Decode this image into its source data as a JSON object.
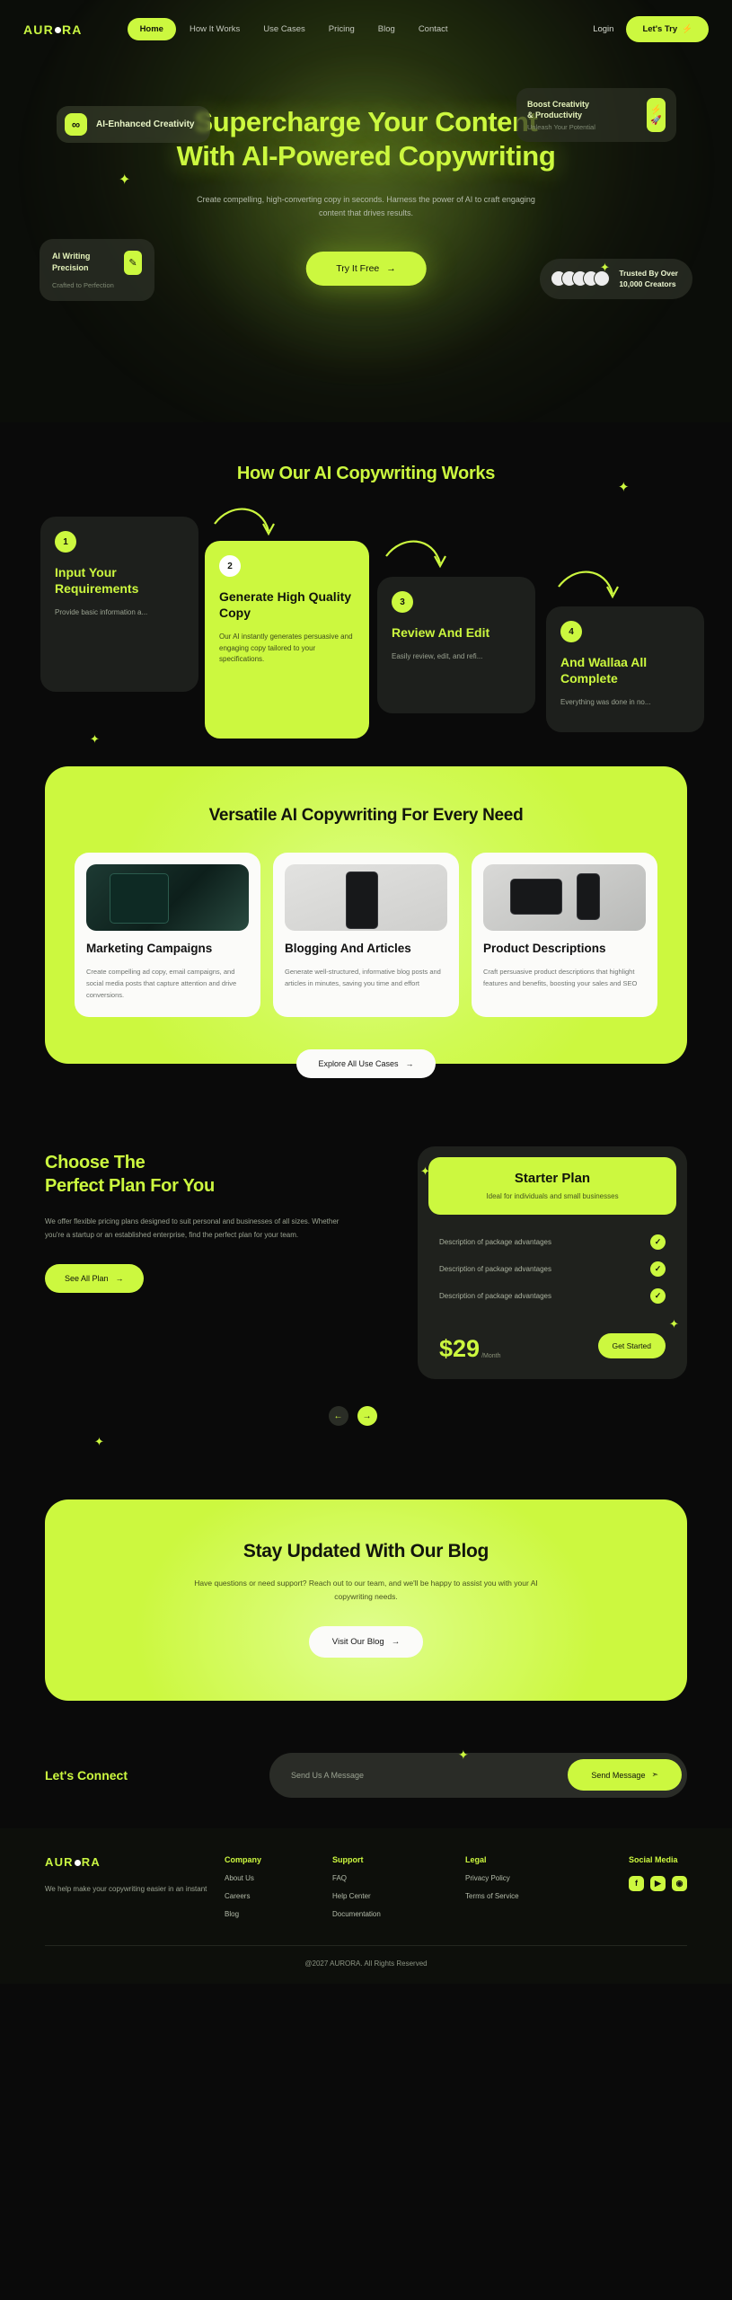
{
  "brand": {
    "name_a": "AUR",
    "name_b": "RA",
    "dot": "o"
  },
  "nav": {
    "links": [
      {
        "label": "Home",
        "active": true
      },
      {
        "label": "How It Works",
        "active": false
      },
      {
        "label": "Use Cases",
        "active": false
      },
      {
        "label": "Pricing",
        "active": false
      },
      {
        "label": "Blog",
        "active": false
      },
      {
        "label": "Contact",
        "active": false
      }
    ],
    "login_label": "Login",
    "cta_label": "Let's Try",
    "cta_icon": "lightning-icon"
  },
  "hero": {
    "badge_ai": {
      "label": "AI-Enhanced Creativity",
      "icon": "infinity-icon"
    },
    "badge_boost": {
      "title_line1": "Boost Creativity",
      "title_line2": "& Productivity",
      "subtitle": "Unleash Your Potential",
      "icon": "lightning-rocket-icon"
    },
    "title_line1": "Supercharge Your Content",
    "title_line2": "With AI-Powered Copywriting",
    "subtitle": "Create compelling, high-converting copy in seconds. Harness the power of AI to craft engaging content that drives results.",
    "cta_label": "Try It Free",
    "cta_icon": "arrow-right-icon",
    "card_precision": {
      "title_line1": "AI Writing",
      "title_line2": "Precision",
      "subtitle": "Crafted to Perfection",
      "icon": "pencil-icon"
    },
    "card_trusted": {
      "line1": "Trusted By Over",
      "line2": "10,000 Creators",
      "avatars": 5
    }
  },
  "how": {
    "title": "How Our AI Copywriting Works",
    "steps": [
      {
        "num": "1",
        "title": "Input Your Requirements",
        "desc": "Provide basic information a...",
        "highlight": false
      },
      {
        "num": "2",
        "title": "Generate High Quality Copy",
        "desc": "Our AI instantly generates persuasive and engaging copy tailored to your specifications.",
        "highlight": true
      },
      {
        "num": "3",
        "title": "Review And Edit",
        "desc": "Easily review, edit, and refi...",
        "highlight": false
      },
      {
        "num": "4",
        "title": "And Wallaa All Complete",
        "desc": "Everything was done in no...",
        "highlight": false
      }
    ]
  },
  "usecases": {
    "title": "Versatile AI Copywriting For Every Need",
    "cards": [
      {
        "image": "laptop-dark-photo",
        "title": "Marketing Campaigns",
        "desc": "Create compelling ad copy, email campaigns, and social media posts that capture attention and drive conversions."
      },
      {
        "image": "hand-holding-phone-photo",
        "title": "Blogging And Articles",
        "desc": "Generate well-structured, informative blog posts and articles in minutes, saving you time and effort"
      },
      {
        "image": "phone-on-desk-photo",
        "title": "Product Descriptions",
        "desc": "Craft persuasive product descriptions that highlight features and benefits, boosting your sales and SEO"
      }
    ],
    "cta_label": "Explore All Use Cases",
    "cta_icon": "arrow-right-icon"
  },
  "pricing": {
    "title_line1": "Choose The",
    "title_line2": "Perfect Plan For You",
    "desc": "We offer flexible pricing plans designed to suit personal and businesses of all sizes. Whether you're a  startup or an established enterprise, find the perfect plan for your team.",
    "cta_label": "See All Plan",
    "cta_icon": "arrow-right-icon",
    "plan": {
      "name": "Starter Plan",
      "tagline": "Ideal for individuals and small businesses",
      "features": [
        "Description of package advantages",
        "Description of package advantages",
        "Description of package advantages"
      ],
      "check_icon": "check-icon",
      "price": "$29",
      "period": "/Month",
      "cta_label": "Get Started"
    },
    "carousel": {
      "prev_icon": "arrow-left-icon",
      "next_icon": "arrow-right-icon"
    }
  },
  "blogcta": {
    "title": "Stay Updated With Our Blog",
    "desc": "Have questions or need support? Reach out to our team, and we'll be happy to assist you with your AI copywriting needs.",
    "cta_label": "Visit Our Blog",
    "cta_icon": "arrow-right-icon"
  },
  "connect": {
    "title": "Let's Connect",
    "input_placeholder": "Send Us A Message",
    "input_value": "",
    "send_label": "Send Message",
    "send_icon": "paper-plane-icon"
  },
  "footer": {
    "tagline": "We help make your copywriting easier in an instant",
    "columns": [
      {
        "heading": "Company",
        "links": [
          "About Us",
          "Careers",
          "Blog"
        ]
      },
      {
        "heading": "Support",
        "links": [
          "FAQ",
          "Help Center",
          "Documentation"
        ]
      },
      {
        "heading": "Legal",
        "links": [
          "Privacy Policy",
          "Terms of Service"
        ]
      }
    ],
    "social_heading": "Social Media",
    "socials": [
      "facebook-icon",
      "youtube-icon",
      "instagram-icon"
    ],
    "copyright": "@2027 AURORA. All Rights Reserved"
  },
  "colors": {
    "accent": "#ccf83f",
    "bg": "#0a0a0a",
    "card": "#1d1f1c",
    "white": "#fbfbf9"
  }
}
